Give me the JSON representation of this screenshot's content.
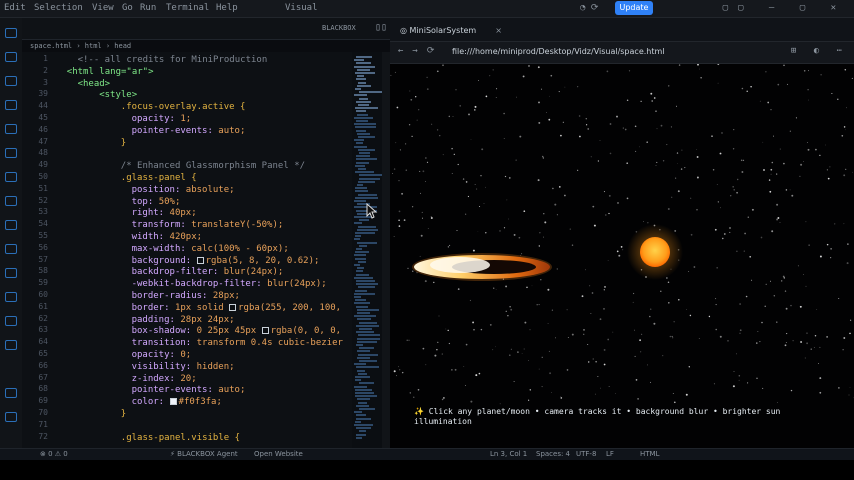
{
  "titlebar": {
    "menu": [
      "Edit",
      "Selection",
      "View",
      "Go",
      "Run",
      "Terminal",
      "Help"
    ],
    "file_label": "Visual",
    "update_label": "Update"
  },
  "editor": {
    "tab_blackbox": "BLACKBOX",
    "breadcrumb": "space.html › html › head",
    "lines": [
      {
        "n": "1",
        "segs": [
          {
            "c": "c-com",
            "t": "<!-- all credits for MiniProduction"
          }
        ],
        "indent": 4
      },
      {
        "n": "2",
        "segs": [
          {
            "c": "c-tag",
            "t": "<html lang=\"ar\">"
          }
        ],
        "indent": 2
      },
      {
        "n": "3",
        "segs": [
          {
            "c": "c-tag",
            "t": "<head>"
          }
        ],
        "indent": 4
      },
      {
        "n": "39",
        "segs": [
          {
            "c": "c-tag",
            "t": "<style>"
          }
        ],
        "indent": 8
      },
      {
        "n": "44",
        "segs": [
          {
            "c": "c-sel",
            "t": ".focus-overlay.active {"
          }
        ],
        "indent": 12
      },
      {
        "n": "45",
        "segs": [
          {
            "c": "c-prop",
            "t": "opacity: "
          },
          {
            "c": "c-val",
            "t": "1;"
          }
        ],
        "indent": 14
      },
      {
        "n": "46",
        "segs": [
          {
            "c": "c-prop",
            "t": "pointer-events: "
          },
          {
            "c": "c-val",
            "t": "auto;"
          }
        ],
        "indent": 14
      },
      {
        "n": "47",
        "segs": [
          {
            "c": "c-sel",
            "t": "}"
          }
        ],
        "indent": 12
      },
      {
        "n": "48",
        "segs": [
          {
            "c": "c-pl",
            "t": ""
          }
        ],
        "indent": 0
      },
      {
        "n": "49",
        "segs": [
          {
            "c": "c-com",
            "t": "/* Enhanced Glassmorphism Panel */"
          }
        ],
        "indent": 12
      },
      {
        "n": "50",
        "segs": [
          {
            "c": "c-sel",
            "t": ".glass-panel {"
          }
        ],
        "indent": 12
      },
      {
        "n": "51",
        "segs": [
          {
            "c": "c-prop",
            "t": "position: "
          },
          {
            "c": "c-val",
            "t": "absolute;"
          }
        ],
        "indent": 14
      },
      {
        "n": "52",
        "segs": [
          {
            "c": "c-prop",
            "t": "top: "
          },
          {
            "c": "c-val",
            "t": "50%;"
          }
        ],
        "indent": 14
      },
      {
        "n": "53",
        "segs": [
          {
            "c": "c-prop",
            "t": "right: "
          },
          {
            "c": "c-val",
            "t": "40px;"
          }
        ],
        "indent": 14
      },
      {
        "n": "54",
        "segs": [
          {
            "c": "c-prop",
            "t": "transform: "
          },
          {
            "c": "c-val",
            "t": "translateY(-50%);"
          }
        ],
        "indent": 14
      },
      {
        "n": "55",
        "segs": [
          {
            "c": "c-prop",
            "t": "width: "
          },
          {
            "c": "c-val",
            "t": "420px;"
          }
        ],
        "indent": 14
      },
      {
        "n": "56",
        "segs": [
          {
            "c": "c-prop",
            "t": "max-width: "
          },
          {
            "c": "c-val",
            "t": "calc(100% - 60px);"
          }
        ],
        "indent": 14
      },
      {
        "n": "57",
        "segs": [
          {
            "c": "c-prop",
            "t": "background: "
          },
          {
            "c": "sw",
            "t": ""
          },
          {
            "c": "c-val",
            "t": "rgba(5, 8, 20, 0.62);"
          }
        ],
        "indent": 14
      },
      {
        "n": "58",
        "segs": [
          {
            "c": "c-prop",
            "t": "backdrop-filter: "
          },
          {
            "c": "c-val",
            "t": "blur(24px);"
          }
        ],
        "indent": 14
      },
      {
        "n": "59",
        "segs": [
          {
            "c": "c-prop",
            "t": "-webkit-backdrop-filter: "
          },
          {
            "c": "c-val",
            "t": "blur(24px);"
          }
        ],
        "indent": 14
      },
      {
        "n": "60",
        "segs": [
          {
            "c": "c-prop",
            "t": "border-radius: "
          },
          {
            "c": "c-val",
            "t": "28px;"
          }
        ],
        "indent": 14
      },
      {
        "n": "61",
        "segs": [
          {
            "c": "c-prop",
            "t": "border: "
          },
          {
            "c": "c-val",
            "t": "1px solid "
          },
          {
            "c": "sw",
            "t": ""
          },
          {
            "c": "c-val",
            "t": "rgba(255, 200, 100,"
          }
        ],
        "indent": 14
      },
      {
        "n": "62",
        "segs": [
          {
            "c": "c-prop",
            "t": "padding: "
          },
          {
            "c": "c-val",
            "t": "28px 24px;"
          }
        ],
        "indent": 14
      },
      {
        "n": "63",
        "segs": [
          {
            "c": "c-prop",
            "t": "box-shadow: "
          },
          {
            "c": "c-val",
            "t": "0 25px 45px "
          },
          {
            "c": "sw",
            "t": ""
          },
          {
            "c": "c-val",
            "t": "rgba(0, 0, 0,"
          }
        ],
        "indent": 14
      },
      {
        "n": "64",
        "segs": [
          {
            "c": "c-prop",
            "t": "transition: "
          },
          {
            "c": "c-val",
            "t": "transform 0.4s cubic-bezier"
          }
        ],
        "indent": 14
      },
      {
        "n": "65",
        "segs": [
          {
            "c": "c-prop",
            "t": "opacity: "
          },
          {
            "c": "c-val",
            "t": "0;"
          }
        ],
        "indent": 14
      },
      {
        "n": "66",
        "segs": [
          {
            "c": "c-prop",
            "t": "visibility: "
          },
          {
            "c": "c-val",
            "t": "hidden;"
          }
        ],
        "indent": 14
      },
      {
        "n": "67",
        "segs": [
          {
            "c": "c-prop",
            "t": "z-index: "
          },
          {
            "c": "c-val",
            "t": "20;"
          }
        ],
        "indent": 14
      },
      {
        "n": "68",
        "segs": [
          {
            "c": "c-prop",
            "t": "pointer-events: "
          },
          {
            "c": "c-val",
            "t": "auto;"
          }
        ],
        "indent": 14
      },
      {
        "n": "69",
        "segs": [
          {
            "c": "c-prop",
            "t": "color: "
          },
          {
            "c": "swl",
            "t": ""
          },
          {
            "c": "c-val",
            "t": "#f0f3fa;"
          }
        ],
        "indent": 14
      },
      {
        "n": "70",
        "segs": [
          {
            "c": "c-sel",
            "t": "}"
          }
        ],
        "indent": 12
      },
      {
        "n": "71",
        "segs": [
          {
            "c": "c-pl",
            "t": ""
          }
        ],
        "indent": 0
      },
      {
        "n": "72",
        "segs": [
          {
            "c": "c-sel",
            "t": ".glass-panel.visible {"
          }
        ],
        "indent": 12
      }
    ]
  },
  "browser": {
    "tab_title": "MiniSolarSystem",
    "tab_close": "×",
    "url": "file:///home/miniprod/Desktop/Vidz/Visual/space.html",
    "hint": "✨ Click any planet/moon • camera tracks it • background blur • brighter sun illumination"
  },
  "statusbar": {
    "branch": "⊗ 0 ⚠ 0",
    "blackbox": "⚡ BLACKBOX Agent",
    "open_website": "Open Website",
    "position": "Ln 3, Col 1",
    "spaces": "Spaces: 4",
    "encoding": "UTF-8",
    "eol": "LF",
    "language": "HTML"
  },
  "colors": {
    "accent": "#2f81f7",
    "sun": "#ffb020",
    "ring": "#ff8a1a"
  }
}
